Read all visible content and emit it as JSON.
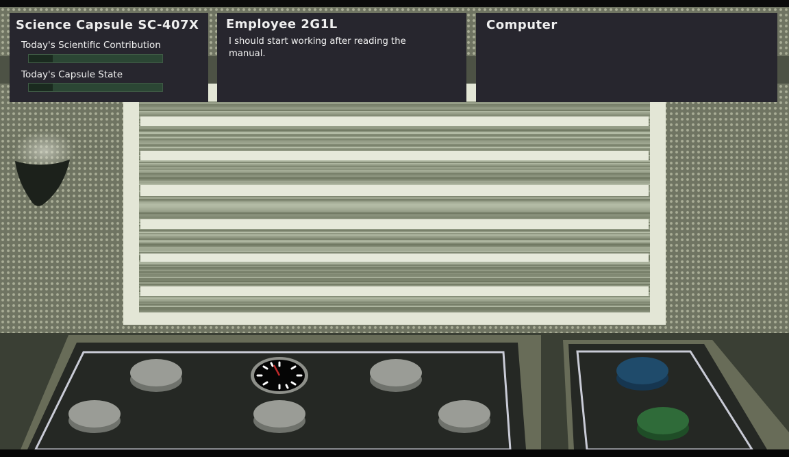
{
  "science_panel": {
    "title": "Science Capsule SC-407X",
    "contribution_label": "Today's Scientific Contribution",
    "contribution_level": 0.18,
    "state_label": "Today's Capsule State",
    "state_level": 0.18
  },
  "employee_panel": {
    "name": "Employee 2G1L",
    "message": "I should start working after reading the manual."
  },
  "computer_panel": {
    "title": "Computer"
  },
  "console": {
    "gray_buttons": [
      "button-1",
      "button-2",
      "button-3",
      "button-4",
      "button-5"
    ],
    "colored_buttons": [
      {
        "name": "blue-button",
        "color": "#1f4b6b"
      },
      {
        "name": "green-button",
        "color": "#2f6b39"
      }
    ],
    "gauge_icon": "clock-gauge-icon"
  },
  "colors": {
    "panel_bg": "#27262e",
    "meter_bg": "#2b4634",
    "screen_frame": "#e3e6d6",
    "console_bg": "#262924"
  }
}
